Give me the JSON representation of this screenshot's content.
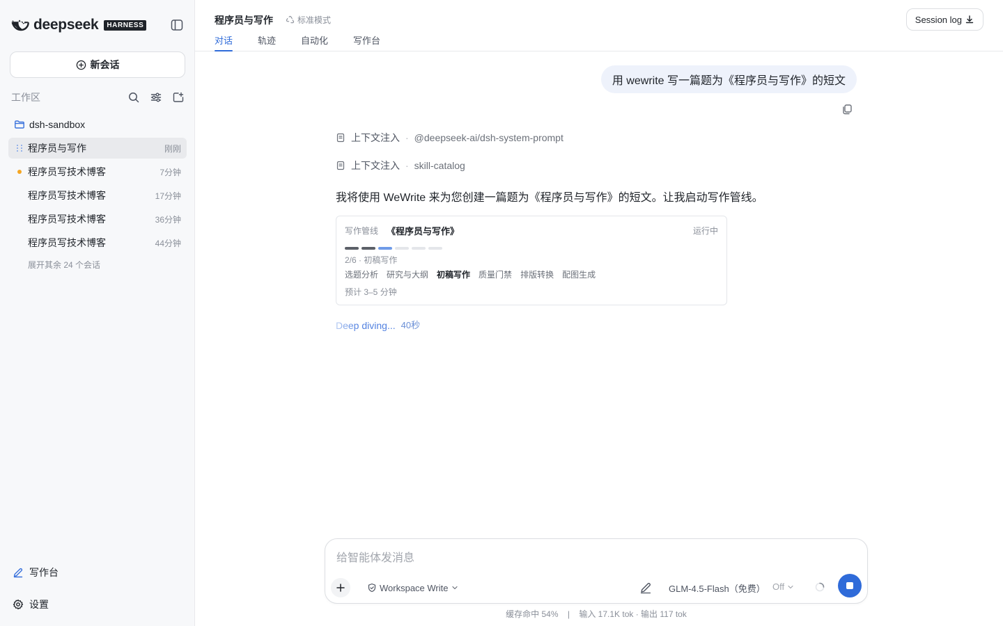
{
  "brand": {
    "name": "deepseek",
    "badge": "HARNESS"
  },
  "sidebar": {
    "new_chat": "新会话",
    "workspace_label": "工作区",
    "folder": "dsh-sandbox",
    "sessions": [
      {
        "title": "程序员与写作",
        "time": "刚刚"
      },
      {
        "title": "程序员写技术博客",
        "time": "7分钟"
      },
      {
        "title": "程序员写技术博客",
        "time": "17分钟"
      },
      {
        "title": "程序员写技术博客",
        "time": "36分钟"
      },
      {
        "title": "程序员写技术博客",
        "time": "44分钟"
      }
    ],
    "more": "展开其余 24 个会话",
    "writing_desk": "写作台",
    "settings": "设置"
  },
  "header": {
    "title": "程序员与写作",
    "mode": "标准模式",
    "tabs": [
      "对话",
      "轨迹",
      "自动化",
      "写作台"
    ],
    "active_tab": 0,
    "session_log": "Session log"
  },
  "conversation": {
    "user_message": "用 wewrite 写一篇题为《程序员与写作》的短文",
    "context": [
      {
        "label": "上下文注入",
        "value": "@deepseek-ai/dsh-system-prompt"
      },
      {
        "label": "上下文注入",
        "value": "skill-catalog"
      }
    ],
    "assistant_text": "我将使用 WeWrite 来为您创建一篇题为《程序员与写作》的短文。让我启动写作管线。",
    "pipeline": {
      "label": "写作管线",
      "title": "《程序员与写作》",
      "status": "运行中",
      "progress_text": "2/6  ·  初稿写作",
      "completed": 2,
      "total": 6,
      "steps": [
        "选题分析",
        "研究与大纲",
        "初稿写作",
        "质量门禁",
        "排版转换",
        "配图生成"
      ],
      "current_step": 2,
      "eta": "预计 3–5 分钟"
    },
    "thinking": {
      "text": "Deep diving...",
      "elapsed": "40秒"
    }
  },
  "composer": {
    "placeholder": "给智能体发消息",
    "permission": "Workspace Write",
    "model": "GLM-4.5-Flash（免费）",
    "thinking": "Off"
  },
  "footer": {
    "cache": "缓存命中 54%",
    "sep": "|",
    "tokens": "输入 17.1K tok · 输出 117 tok"
  },
  "colors": {
    "accent": "#2f6bd9",
    "bar_done": "#5c6068",
    "bar_pending": "#e4e6ea",
    "dot_status": "#f5a623"
  }
}
